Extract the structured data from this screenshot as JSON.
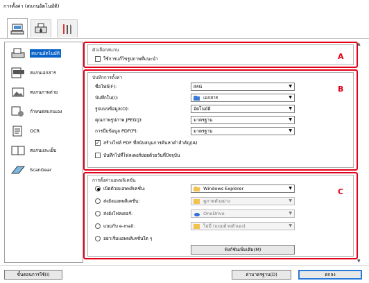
{
  "window": {
    "title": "การตั้งค่า (สแกนอัตโนมัติ)"
  },
  "tabs": [
    {
      "icon": "scan-from-computer-icon"
    },
    {
      "icon": "scan-from-panel-icon"
    },
    {
      "icon": "general-settings-icon"
    }
  ],
  "sidebar": {
    "items": [
      {
        "label": "สแกนอัตโนมัติ",
        "icon": "auto-scan-icon"
      },
      {
        "label": "สแกนเอกสาร",
        "icon": "document-scan-icon"
      },
      {
        "label": "สแกนภาพถ่าย",
        "icon": "photo-scan-icon"
      },
      {
        "label": "กำหนดสแกนเอง",
        "icon": "custom-scan-icon"
      },
      {
        "label": "OCR",
        "icon": "ocr-icon"
      },
      {
        "label": "สแกนและเย็บ",
        "icon": "scan-stitch-icon"
      },
      {
        "label": "ScanGear",
        "icon": "scangear-icon"
      }
    ]
  },
  "scan_options": {
    "title": "ตัวเลือกสแกน",
    "recommended_correction": {
      "label": "ใช้การแก้ไขรูปภาพที่แนะนำ",
      "checked": false
    },
    "badge": "A"
  },
  "save_settings": {
    "title": "บันทึกการตั้งค่า",
    "badge": "B",
    "fields": [
      {
        "label": "ชื่อไฟล์(F):",
        "value": "IMG"
      },
      {
        "label": "บันทึกใน(I):",
        "value": "เอกสาร",
        "icon": "documents-folder-icon"
      },
      {
        "label": "รูปแบบข้อมูล(O):",
        "value": "อัตโนมัติ"
      },
      {
        "label": "คุณภาพรูปภาพ JPEG(J):",
        "value": "มาตรฐาน"
      },
      {
        "label": "การบีบข้อมูล PDF(P):",
        "value": "มาตรฐาน"
      }
    ],
    "searchable_pdf": {
      "label": "สร้างไฟล์ PDF ที่สนับสนุนการค้นหาคำสำคัญ(A)",
      "checked": true
    },
    "save_subfolder": {
      "label": "บันทึกไปที่โฟลเดอร์ย่อยด้วยวันที่ปัจจุบัน",
      "checked": false
    }
  },
  "app_settings": {
    "title": "การตั้งค่าแอพพลิเคชั่น",
    "badge": "C",
    "options": [
      {
        "label": "เปิดด้วยแอพพลิเคชั่น:",
        "selected": true,
        "value": "Windows Explorer",
        "icon": "windows-explorer-icon",
        "enabled": true
      },
      {
        "label": "ส่งยังแอพพลิเคชั่น:",
        "selected": false,
        "value": "ดูภาพตัวอย่าง",
        "icon": "preview-icon",
        "enabled": false
      },
      {
        "label": "ส่งยังโฟลเดอร์:",
        "selected": false,
        "value": "OneDrive",
        "icon": "onedrive-icon",
        "enabled": false
      },
      {
        "label": "แนบกับ e-mail:",
        "selected": false,
        "value": "ไม่มี (แนบด้วยตัวเอง)",
        "icon": "email-icon",
        "enabled": false
      },
      {
        "label": "อย่าเริ่มแอพพลิเคชั่นใด ๆ",
        "selected": false,
        "value": null,
        "icon": null,
        "enabled": false
      }
    ],
    "more_functions_button": "ฟังก์ชันเพิ่มเติม(M)"
  },
  "footer": {
    "instructions_button": "ขั้นตอนการใช้(I)",
    "defaults_button": "ค่ามาตรฐาน(D)",
    "ok_button": "ตกลง"
  },
  "colors": {
    "accent": "#e2001a",
    "selection": "#0a64c8"
  }
}
